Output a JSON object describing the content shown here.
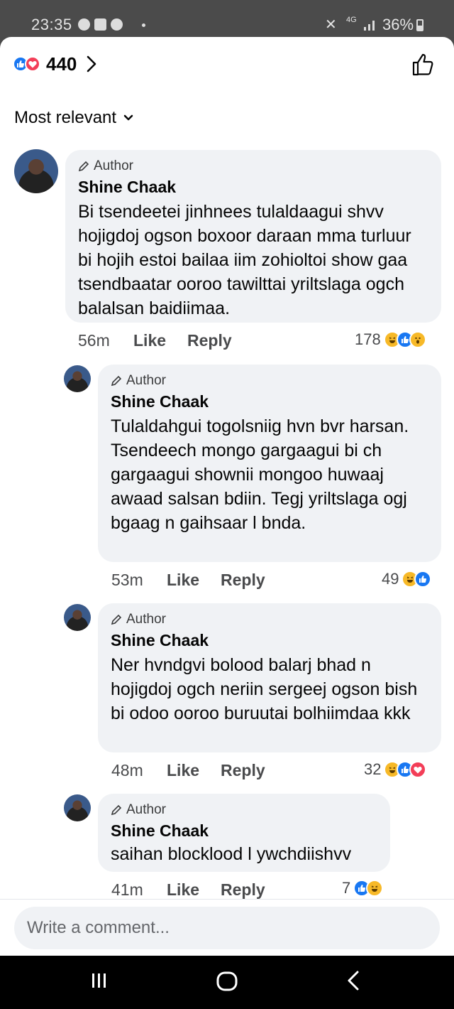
{
  "status_bar": {
    "time": "23:35",
    "network": "4G",
    "battery": "36%"
  },
  "header": {
    "reaction_count": "440",
    "reaction_icons": [
      "like-icon",
      "love-icon"
    ]
  },
  "sort": {
    "label": "Most relevant"
  },
  "comments": [
    {
      "author_badge": "Author",
      "name": "Shine Chaak",
      "text": "Bi tsendeetei jinhnees tulaldaagui shvv hojigdoj ogson boxoor daraan mma turluur bi hojih estoi bailaa iim zohioltoi show gaa tsendbaatar ooroo tawilttai yriltslaga ogch balalsan baidiimaa.",
      "time": "56m",
      "like_label": "Like",
      "reply_label": "Reply",
      "reaction_count": "178",
      "reactions": [
        "haha",
        "like",
        "wow"
      ]
    },
    {
      "author_badge": "Author",
      "name": "Shine Chaak",
      "text": "Tulaldahgui togolsniig hvn bvr harsan. Tsendeech mongo gargaagui bi ch gargaagui shownii mongoo huwaaj awaad salsan bdiin. Tegj yriltslaga ogj bgaag n gaihsaar l bnda.",
      "time": "53m",
      "like_label": "Like",
      "reply_label": "Reply",
      "reaction_count": "49",
      "reactions": [
        "haha",
        "like"
      ]
    },
    {
      "author_badge": "Author",
      "name": "Shine Chaak",
      "text": "Ner hvndgvi bolood balarj bhad n hojigdoj ogch neriin sergeej ogson bish bi odoo ooroo buruutai bolhiimdaa kkk",
      "time": "48m",
      "like_label": "Like",
      "reply_label": "Reply",
      "reaction_count": "32",
      "reactions": [
        "haha",
        "like",
        "love"
      ]
    },
    {
      "author_badge": "Author",
      "name": "Shine Chaak",
      "text": "saihan blocklood l ywchdiishvv",
      "time": "41m",
      "like_label": "Like",
      "reply_label": "Reply",
      "reaction_count": "7",
      "reactions": [
        "like",
        "haha"
      ]
    }
  ],
  "composer": {
    "placeholder": "Write a comment..."
  },
  "nav": {
    "recents": "recents-icon",
    "home": "home-icon",
    "back": "back-icon"
  },
  "colors": {
    "like_blue": "#1877f2",
    "love_red": "#f33e58",
    "haha_yellow": "#f7b928",
    "bubble_bg": "#f0f2f5"
  }
}
